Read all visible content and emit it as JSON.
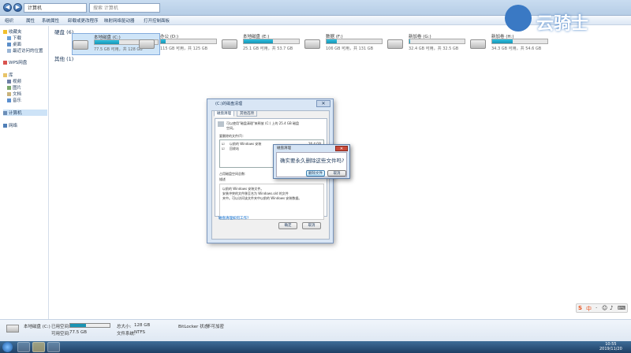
{
  "window": {
    "address": "计算机",
    "search_placeholder": "搜索 计算机",
    "toolbar": [
      "组织",
      "属性",
      "系统属性",
      "卸载或更改程序",
      "映射网络驱动器",
      "打开控制面板"
    ]
  },
  "watermark": {
    "text": "云骑士"
  },
  "sidebar": {
    "favorites": "收藏夹",
    "fav_items": [
      "下载",
      "桌面",
      "最近访问的位置"
    ],
    "wps": "WPS网盘",
    "libraries": "库",
    "lib_items": [
      "视频",
      "图片",
      "文档",
      "音乐"
    ],
    "computer": "计算机",
    "network": "网络"
  },
  "groups": {
    "hdd": "硬盘 (6)",
    "other": "其他 (1)"
  },
  "drives": [
    {
      "name": "本地磁盘 (C:)",
      "size": "77.5 GB 可用，共 128 GB",
      "used": 0.39
    },
    {
      "name": "办公 (D:)",
      "size": "115 GB 可用，共 125 GB",
      "used": 0.08
    },
    {
      "name": "本地磁盘 (E:)",
      "size": "25.1 GB 可用，共 53.7 GB",
      "used": 0.53
    },
    {
      "name": "数据 (F:)",
      "size": "106 GB 可用，共 131 GB",
      "used": 0.19
    },
    {
      "name": "新加卷 (G:)",
      "size": "32.4 GB 可用，共 32.5 GB",
      "used": 0.01
    },
    {
      "name": "新加卷 (H:)",
      "size": "34.3 GB 可用，共 54.6 GB",
      "used": 0.37
    }
  ],
  "status": {
    "name": "本地磁盘 (C:)",
    "used_label": "已用空间:",
    "free_label": "可用空间:",
    "free": "77.5 GB",
    "total_label": "总大小:",
    "total": "128 GB",
    "fs_label": "文件系统:",
    "fs": "NTFS",
    "bitlocker_label": "BitLocker 状态:",
    "bitlocker": "不可加密",
    "used_fraction": 0.39
  },
  "cleanup": {
    "title": "(C:)的磁盘清理",
    "tab1": "磁盘清理",
    "tab2": "其他选项",
    "intro1": "可以使用\"磁盘清理\"来释放 (C:) 上的 25.4 GB 磁盘",
    "intro2": "空间。",
    "files_label": "要删除的文件(F):",
    "items": [
      {
        "name": "以前的 Windows 安装",
        "size": "26.4 GB"
      },
      {
        "name": "回收站",
        "size": "0 字节"
      }
    ],
    "total_label": "占用磁盘空间总数:",
    "desc_label": "描述",
    "desc_lines": [
      "以前的 Windows 安装文件。",
      "安装冲突的文件移至名为 Windows.old 的文件",
      "夹中。可以访问该文件夹中以前的 Windows 安装数据。"
    ],
    "link": "磁盘清理如何工作?",
    "ok": "确定",
    "cancel": "取消"
  },
  "confirm": {
    "title": "磁盘清理",
    "message": "确实要永久删除这些文件吗?",
    "delete": "删除文件",
    "cancel": "取消"
  },
  "clock": {
    "time": "10:55",
    "date": "2019/11/20"
  }
}
